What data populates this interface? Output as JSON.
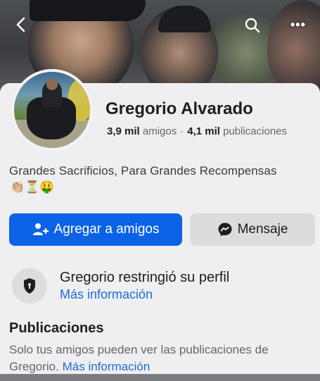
{
  "nav": {
    "back_icon": "back-chevron-icon",
    "search_icon": "search-icon",
    "more_icon": "more-options-icon",
    "more_glyph": "•••"
  },
  "profile": {
    "name": "Gregorio Alvarado",
    "friends_count": "3,9 mil",
    "friends_label": "amigos",
    "separator": "·",
    "posts_count": "4,1 mil",
    "posts_label": "publicaciones",
    "bio": "Grandes Sacrificios, Para Grandes Recompensas",
    "bio_emojis": "👏🏼⏳🤑"
  },
  "actions": {
    "add_friend_label": "Agregar a amigos",
    "message_label": "Mensaje",
    "add_friend_color": "#0b62e6",
    "message_bg_color": "#dcdcde"
  },
  "restriction": {
    "title": "Gregorio restringió su perfil",
    "link": "Más información",
    "icon": "shield-icon"
  },
  "posts_section": {
    "title": "Publicaciones",
    "text_line1": "Solo tus amigos pueden ver las publicaciones de",
    "text_line2_prefix": "Gregorio.",
    "link": "Más información"
  },
  "colors": {
    "accent_blue": "#0b62e6",
    "link_blue": "#1b6ed6",
    "muted_text": "#65676b"
  }
}
